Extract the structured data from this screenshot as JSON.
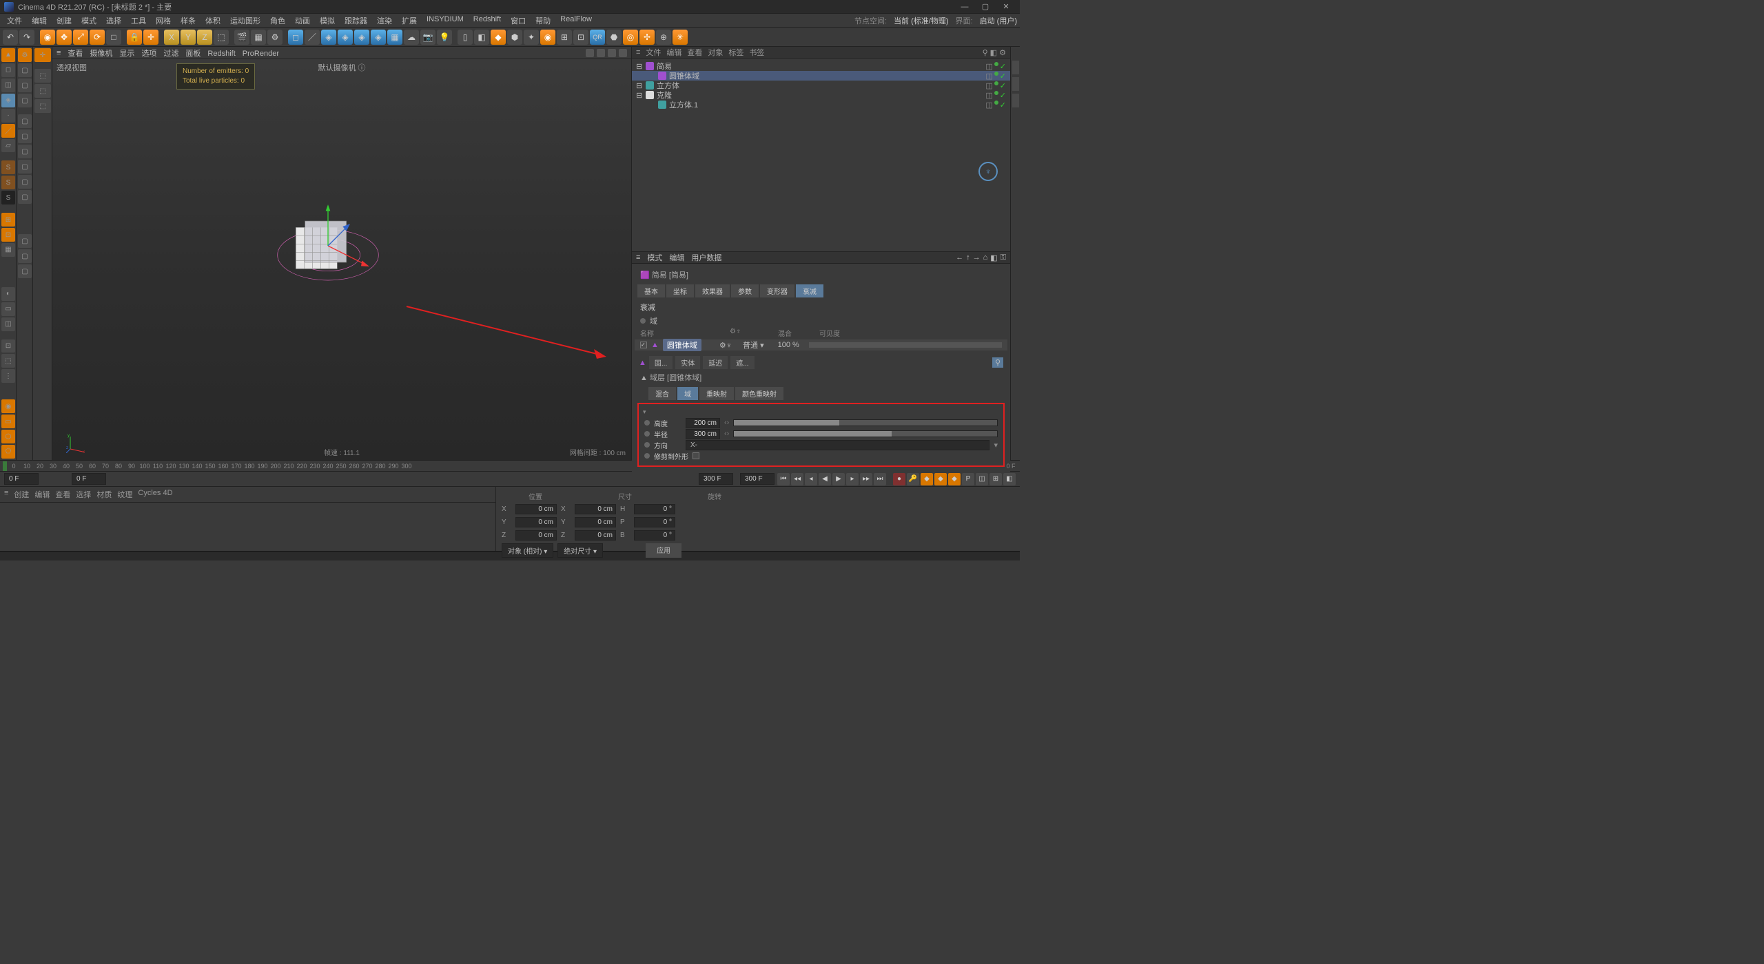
{
  "title": "Cinema 4D R21.207 (RC) - [未标题 2 *] - 主要",
  "menubar": [
    "文件",
    "编辑",
    "创建",
    "模式",
    "选择",
    "工具",
    "网格",
    "样条",
    "体积",
    "运动图形",
    "角色",
    "动画",
    "模拟",
    "跟踪器",
    "渲染",
    "扩展",
    "INSYDIUM",
    "Redshift",
    "窗口",
    "帮助",
    "RealFlow"
  ],
  "menubar_right": {
    "node_space_lbl": "节点空间:",
    "node_space_val": "当前 (标准/物理)",
    "layout_lbl": "界面:",
    "layout_val": "启动 (用户)"
  },
  "viewport_menu": [
    "查看",
    "摄像机",
    "显示",
    "选项",
    "过滤",
    "面板",
    "Redshift",
    "ProRender"
  ],
  "viewport": {
    "label": "透视视图",
    "camera": "默认摄像机",
    "emitters": "Number of emitters: 0",
    "particles": "Total live particles: 0",
    "fps": "帧速 : 111.1",
    "grid": "网格间距 : 100 cm"
  },
  "objects_panel_tabs": [
    "文件",
    "编辑",
    "查看",
    "对象",
    "标签",
    "书签"
  ],
  "objects": [
    {
      "name": "简易",
      "depth": 0,
      "icon": "purple",
      "sel": false
    },
    {
      "name": "圆锥体域",
      "depth": 1,
      "icon": "purple",
      "sel": true
    },
    {
      "name": "立方体",
      "depth": 0,
      "icon": "teal",
      "sel": false
    },
    {
      "name": "克隆",
      "depth": 0,
      "icon": "white",
      "sel": false
    },
    {
      "name": "立方体.1",
      "depth": 1,
      "icon": "teal",
      "sel": false
    }
  ],
  "attr_tabs": [
    "模式",
    "编辑",
    "用户数据"
  ],
  "attr_title_prefix": "简易 [简易]",
  "attr_maintabs": [
    "基本",
    "坐标",
    "效果器",
    "参数",
    "变形器",
    "衰减"
  ],
  "attr_maintabs_active": 5,
  "falloff_section": "衰减",
  "falloff_sub_label": "域",
  "falloff_cols": [
    "名称",
    "混合",
    "可见度"
  ],
  "falloff_item": {
    "name": "圆锥体域",
    "mode": "普通",
    "vis": "100 %"
  },
  "layer_tabs": [
    "混合",
    "域",
    "重映射",
    "颜色重映射"
  ],
  "layer_tabs_active": 1,
  "layer_title_prefix": "域层 [圆锥体域]",
  "layer_btns": [
    "固...",
    "实体",
    "延迟",
    "遮..."
  ],
  "props": {
    "height_lbl": "高度",
    "height_val": "200 cm",
    "height_pct": 40,
    "radius_lbl": "半径",
    "radius_val": "300 cm",
    "radius_pct": 60,
    "dir_lbl": "方向",
    "dir_val": "X-",
    "clip_lbl": "修剪到外形"
  },
  "timeline": {
    "from": 0,
    "to": 300,
    "step": 10,
    "current": "0 F",
    "end": "300 F"
  },
  "bottom_tabs": [
    "创建",
    "编辑",
    "查看",
    "选择",
    "材质",
    "纹理",
    "Cycles 4D"
  ],
  "coords": {
    "pos": "位置",
    "size": "尺寸",
    "rot": "旋转",
    "rows": [
      {
        "a": "X",
        "av": "0 cm",
        "b": "X",
        "bv": "0 cm",
        "c": "H",
        "cv": "0 °"
      },
      {
        "a": "Y",
        "av": "0 cm",
        "b": "Y",
        "bv": "0 cm",
        "c": "P",
        "cv": "0 °"
      },
      {
        "a": "Z",
        "av": "0 cm",
        "b": "Z",
        "bv": "0 cm",
        "c": "B",
        "cv": "0 °"
      }
    ],
    "mode1": "对象 (相对)",
    "mode2": "绝对尺寸",
    "apply": "应用"
  }
}
